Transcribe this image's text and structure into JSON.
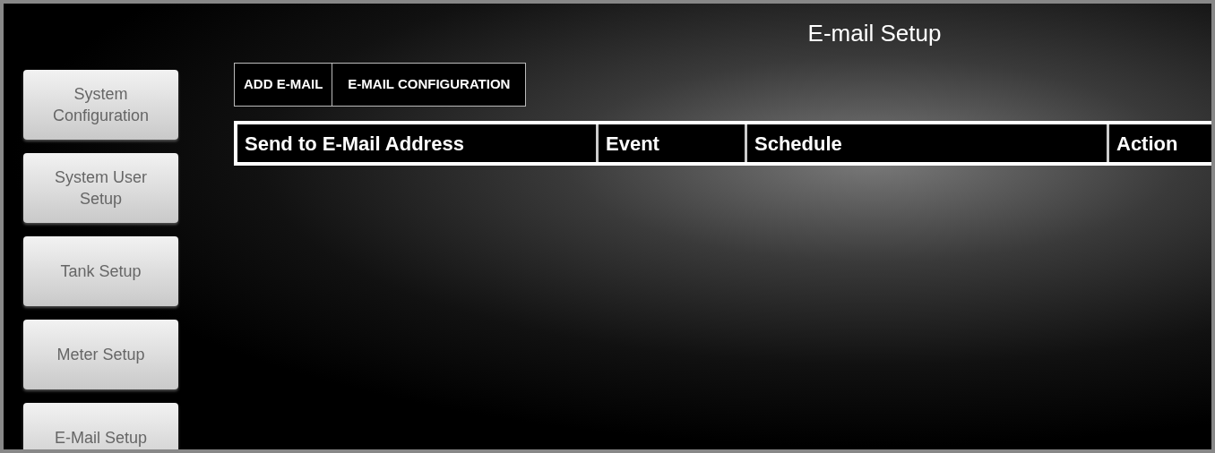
{
  "header": {
    "title": "E-mail Setup"
  },
  "sidebar": {
    "items": [
      {
        "label": "System Configuration"
      },
      {
        "label": "System User Setup"
      },
      {
        "label": "Tank Setup"
      },
      {
        "label": "Meter Setup"
      },
      {
        "label": "E-Mail Setup"
      }
    ]
  },
  "tabs": [
    {
      "label": "ADD E-MAIL"
    },
    {
      "label": "E-MAIL CONFIGURATION"
    }
  ],
  "table": {
    "columns": [
      "Send to E-Mail Address",
      "Event",
      "Schedule",
      "Action"
    ]
  }
}
